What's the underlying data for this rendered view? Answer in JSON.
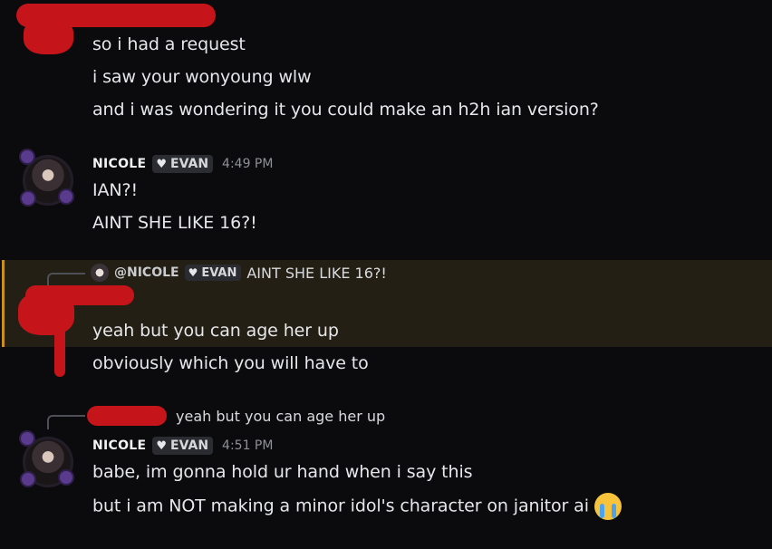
{
  "messages": {
    "m1_lines": [
      "so i had a request",
      "i saw your wonyoung wlw",
      "and i was wondering it you could make an h2h ian version?"
    ],
    "m2": {
      "name": "NICOLE",
      "tag": "EVAN",
      "time": "4:49 PM",
      "lines": [
        "IAN?!",
        "AINT SHE LIKE 16?!"
      ]
    },
    "reply1": {
      "ref_name": "@NICOLE",
      "ref_tag": "EVAN",
      "ref_text": "AINT SHE LIKE 16?!",
      "lines": [
        "yeah but you can age her up",
        "obviously which you will have to"
      ]
    },
    "reply2": {
      "ref_text": "yeah but you can age her up",
      "name": "NICOLE",
      "tag": "EVAN",
      "time": "4:51 PM",
      "lines": [
        "babe, im gonna hold ur hand when i say this",
        "but i am NOT making a minor idol's character on janitor ai"
      ]
    }
  },
  "icons": {
    "tag_icon": "heart-icon",
    "emoji": "loudly-crying-face-emoji"
  }
}
